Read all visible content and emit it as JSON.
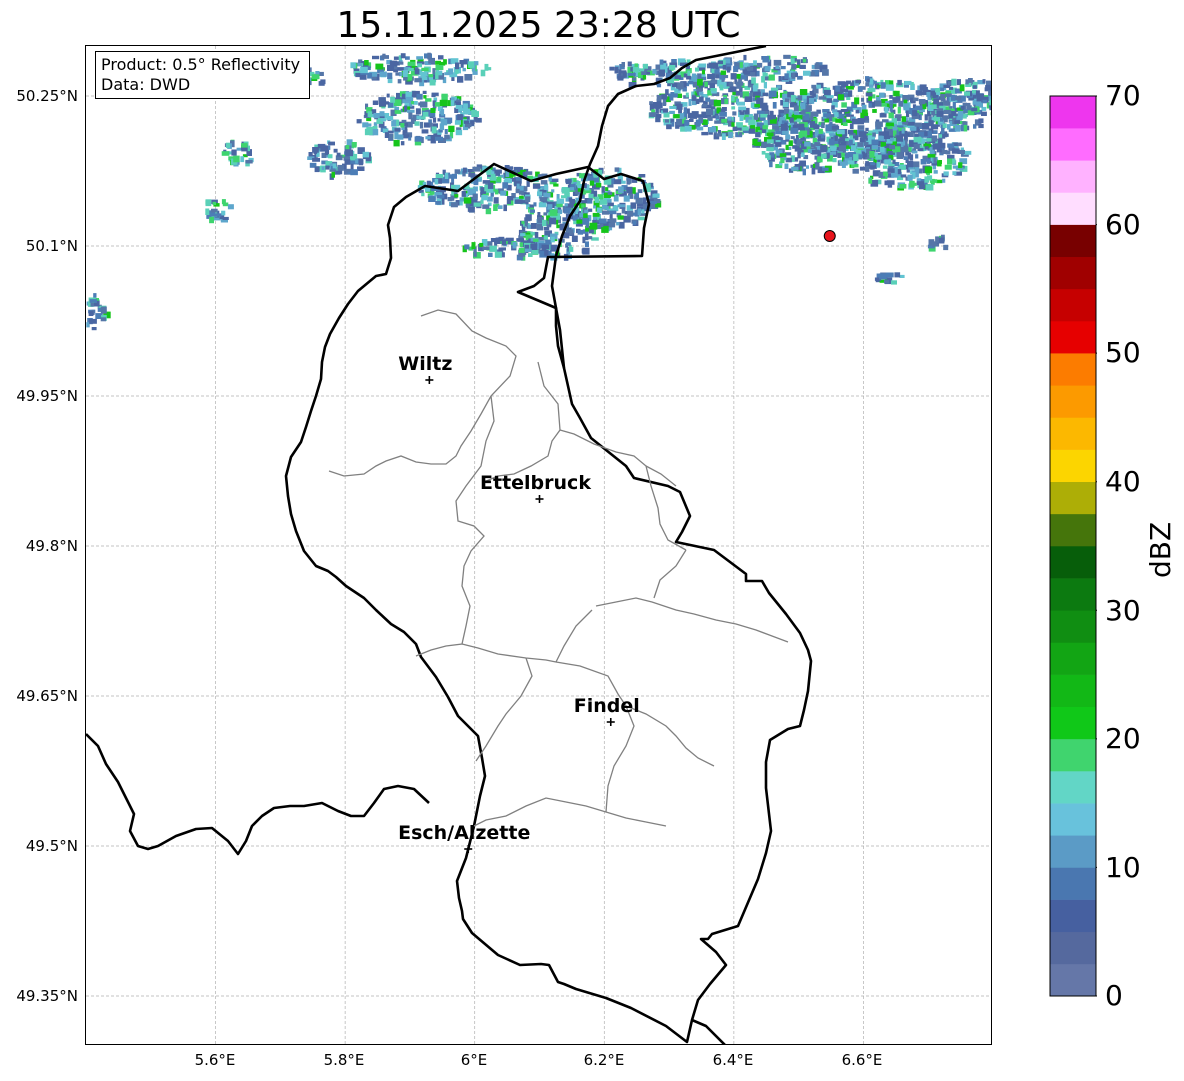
{
  "title": "15.11.2025 23:28 UTC",
  "info_box": {
    "product": "Product: 0.5° Reflectivity",
    "data_source": "Data: DWD"
  },
  "latitude_ticks": [
    "50.25°N",
    "50.1°N",
    "49.95°N",
    "49.8°N",
    "49.65°N",
    "49.5°N",
    "49.35°N"
  ],
  "longitude_ticks": [
    "5.6°E",
    "5.8°E",
    "6°E",
    "6.2°E",
    "6.4°E",
    "6.6°E"
  ],
  "cities": [
    {
      "name": "Wiltz",
      "lon": 5.93,
      "lat": 49.966
    },
    {
      "name": "Ettelbruck",
      "lon": 6.1,
      "lat": 49.847
    },
    {
      "name": "Findel",
      "lon": 6.21,
      "lat": 49.624
    },
    {
      "name": "Esch/Alzette",
      "lon": 5.99,
      "lat": 49.497
    }
  ],
  "radar_site": {
    "lon": 6.548,
    "lat": 50.11,
    "color": "#e8141c"
  },
  "colorbar": {
    "label": "dBZ",
    "ticks": [
      "0",
      "10",
      "20",
      "30",
      "40",
      "50",
      "60",
      "70"
    ],
    "min": 0,
    "max": 70,
    "step": 2.5,
    "colors": [
      "#6577a8",
      "#55699e",
      "#4660a0",
      "#4a77b0",
      "#5b9bc6",
      "#68c2dc",
      "#62d6c6",
      "#40d46e",
      "#10c818",
      "#12b816",
      "#12a514",
      "#108e12",
      "#0c7a10",
      "#075e0a",
      "#45750b",
      "#adae06",
      "#fcd500",
      "#fcb800",
      "#fc9a00",
      "#fc7c00",
      "#e60000",
      "#c60000",
      "#a00000",
      "#780000",
      "#ffddff",
      "#ffb2ff",
      "#ff6cff",
      "#ee36ee"
    ]
  },
  "map_extent": {
    "lon_min": 5.4,
    "lon_max": 6.8,
    "lat_min": 49.3,
    "lat_max": 50.3
  }
}
